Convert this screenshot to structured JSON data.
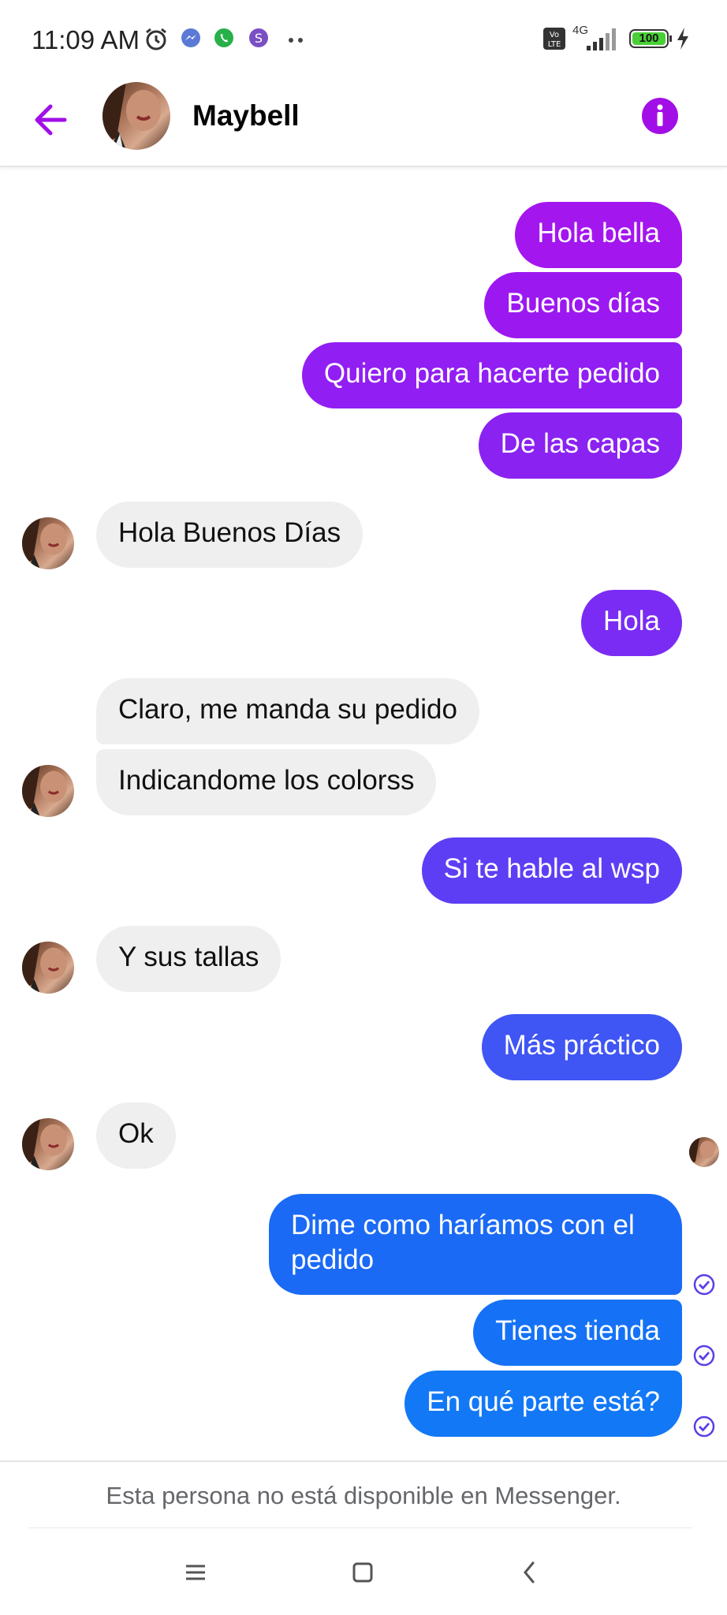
{
  "status_bar": {
    "time": "11:09 AM",
    "network": "4G",
    "battery": "100",
    "icons": [
      "alarm-icon",
      "messenger-icon",
      "whatsapp-icon",
      "viber-icon",
      "more-dots-icon",
      "volte-icon",
      "signal-icon",
      "battery-icon",
      "charging-icon"
    ]
  },
  "header": {
    "contact_name": "Maybell",
    "back_icon": "arrow-left-icon",
    "info_icon": "info-icon",
    "accent": "#a20fe6"
  },
  "messages": [
    {
      "side": "out",
      "text": "Hola bella",
      "color": "#a316ee"
    },
    {
      "side": "out",
      "text": "Buenos días",
      "color": "#9c18f0"
    },
    {
      "side": "out",
      "text": "Quiero para hacerte pedido",
      "color": "#911ef2"
    },
    {
      "side": "out",
      "text": "De las capas",
      "color": "#8a22f2"
    },
    {
      "side": "in",
      "text": "Hola Buenos Días"
    },
    {
      "side": "out",
      "text": "Hola",
      "color": "#7a2cf4"
    },
    {
      "side": "in",
      "text": "Claro, me manda su pedido"
    },
    {
      "side": "in",
      "text": "Indicandome los colorss"
    },
    {
      "side": "out",
      "text": "Si te hable al wsp",
      "color": "#5e3ef4"
    },
    {
      "side": "in",
      "text": "Y sus tallas"
    },
    {
      "side": "out",
      "text": "Más práctico",
      "color": "#3f55f4"
    },
    {
      "side": "in",
      "text": "Ok"
    },
    {
      "side": "out",
      "text_line1": "Dime como haríamos con el",
      "text_line2": "pedido",
      "color": "#1a6af5"
    },
    {
      "side": "out",
      "text": "Tienes tienda",
      "color": "#1572f6"
    },
    {
      "side": "out",
      "text": "En qué parte está?",
      "color": "#1278f6"
    }
  ],
  "footer": {
    "notice": "Esta persona no está disponible en Messenger."
  },
  "nav": {
    "menu_icon": "menu-icon",
    "home_icon": "home-square-icon",
    "back_icon": "back-chevron-icon"
  }
}
